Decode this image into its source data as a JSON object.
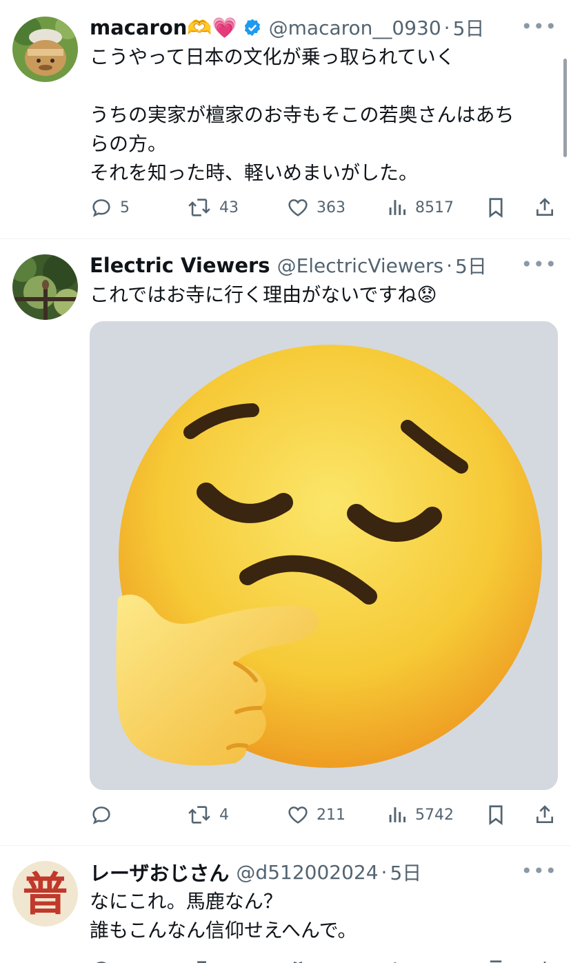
{
  "tweets": [
    {
      "name": "macaron🫶💗",
      "handle": "@macaron__0930",
      "time": "5日",
      "text": [
        "こうやって日本の文化が乗っ取られていく",
        "",
        "うちの実家が檀家のお寺もそこの若奥さんはあち",
        "らの方。",
        "それを知った時、軽いめまいがした。"
      ],
      "replies": "5",
      "retweets": "43",
      "likes": "363",
      "views": "8517"
    },
    {
      "name": "Electric Viewers",
      "handle": "@ElectricViewers",
      "time": "5日",
      "text": [
        "これではお寺に行く理由がないですね😟"
      ],
      "media_icon": "thinking-face-emoji",
      "replies": "",
      "retweets": "4",
      "likes": "211",
      "views": "5742"
    },
    {
      "name": "レーザおじさん",
      "handle": "@d512002024",
      "time": "5日",
      "avatar_char": "普",
      "text": [
        "なにこれ。馬鹿なん？",
        "誰もこんなん信仰せえへんで。"
      ]
    }
  ],
  "colors": {
    "verified": "#1d9bf0",
    "muted": "#536471",
    "divider": "#eff3f4"
  }
}
